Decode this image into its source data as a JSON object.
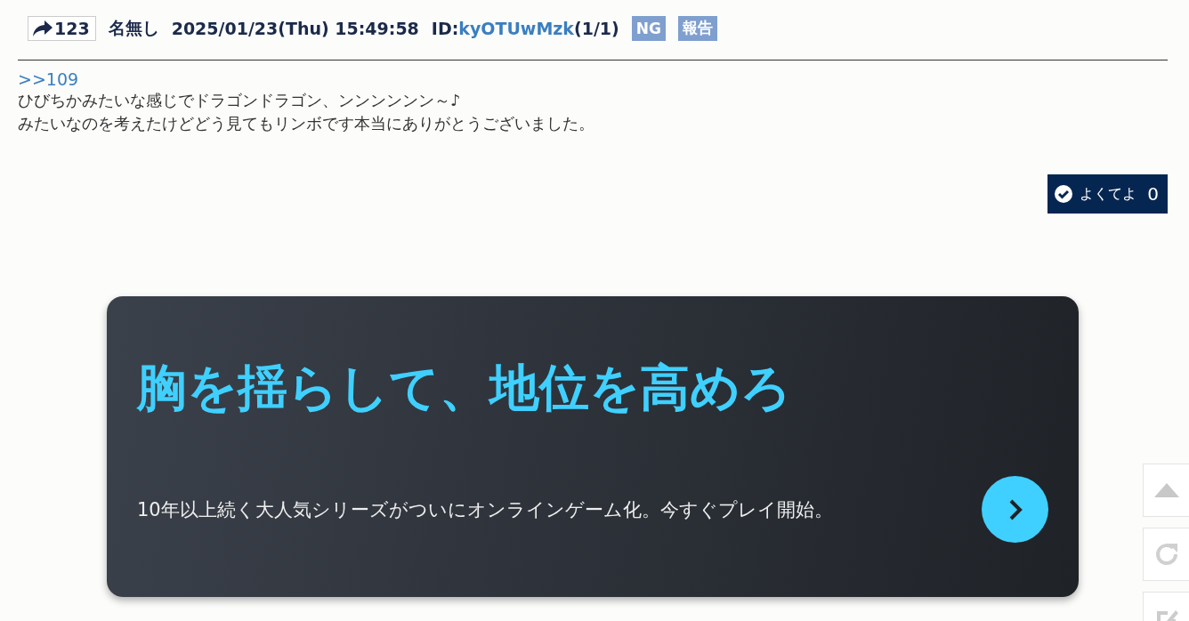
{
  "post": {
    "number": "123",
    "name": "名無し",
    "date": "2025/01/23(Thu) 15:49:58",
    "id_label": "ID:",
    "id": "kyOTUwMzk",
    "id_count": "(1/1)",
    "buttons": [
      "NG",
      "報告"
    ],
    "anchor": ">>109",
    "lines": [
      "ひびちかみたいな感じでドラゴンドラゴン、ンンンンンン～♪",
      "みたいなのを考えたけどどう見てもリンボです本当にありがとうございました。"
    ],
    "like": {
      "label": "よくてよ",
      "count": "0"
    }
  },
  "ad": {
    "headline": "胸を揺らして、地位を高めろ",
    "text": "10年以上続く大人気シリーズがついにオンラインゲーム化。今すぐプレイ開始。"
  },
  "side_buttons": [
    {
      "kind": "top"
    },
    {
      "kind": "reload"
    },
    {
      "kind": "write"
    }
  ]
}
